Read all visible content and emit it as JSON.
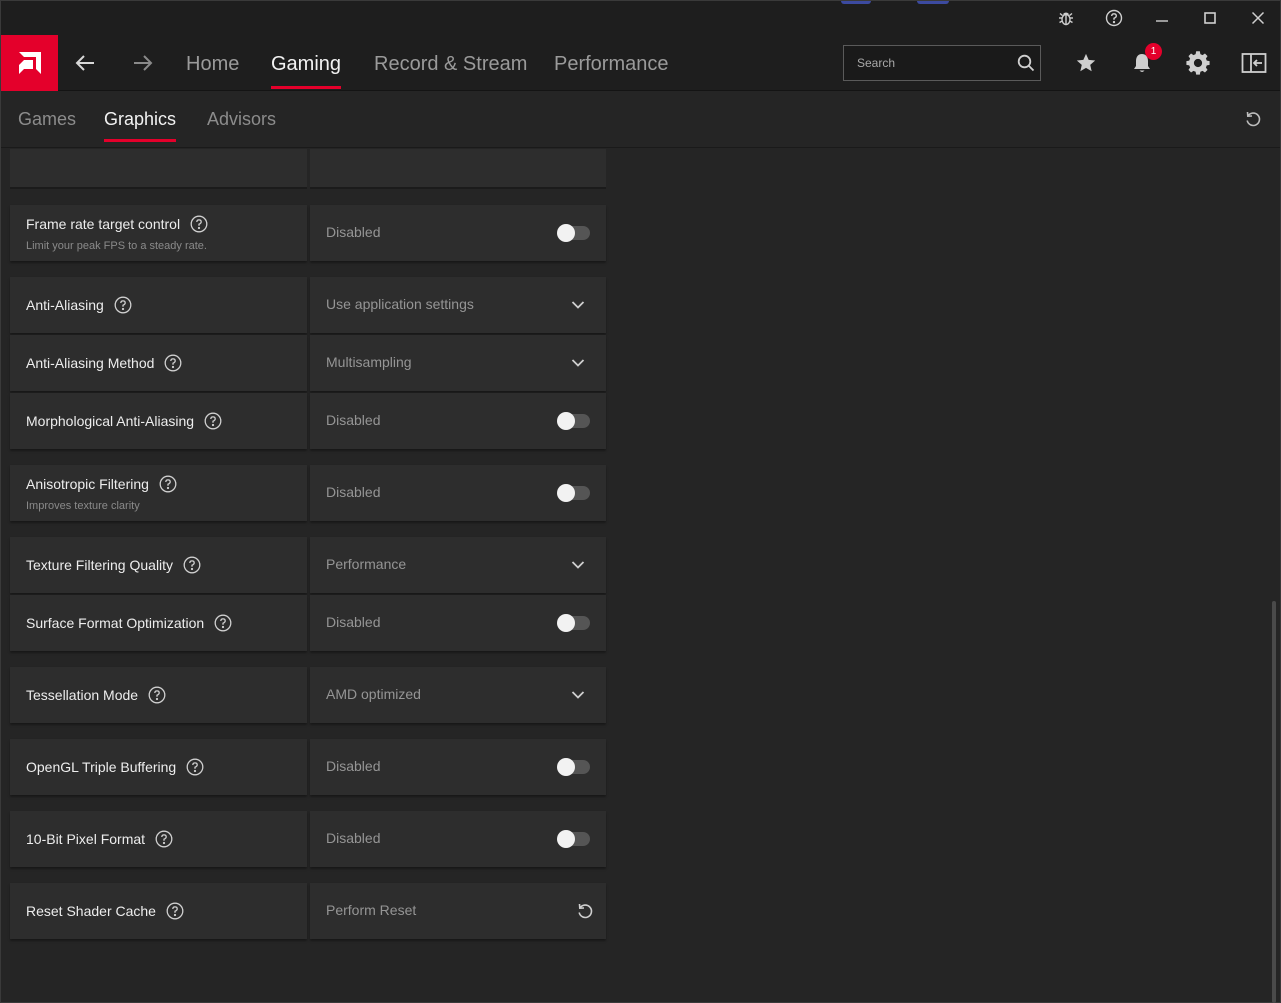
{
  "titlebar": {
    "icons": [
      "bug-icon",
      "help-icon",
      "minimize-icon",
      "maximize-icon",
      "close-icon"
    ]
  },
  "nav": {
    "links": [
      {
        "label": "Home",
        "active": false
      },
      {
        "label": "Gaming",
        "active": true
      },
      {
        "label": "Record & Stream",
        "active": false
      },
      {
        "label": "Performance",
        "active": false
      }
    ],
    "search_placeholder": "Search",
    "notification_count": "1"
  },
  "subtabs": [
    {
      "label": "Games",
      "active": false
    },
    {
      "label": "Graphics",
      "active": true
    },
    {
      "label": "Advisors",
      "active": false
    }
  ],
  "settings": [
    {
      "label": "Frame rate target control",
      "sublabel": "Limit your peak FPS to a steady rate.",
      "value": "Disabled",
      "control": "toggle",
      "on": false
    },
    {
      "label": "Anti-Aliasing",
      "value": "Use application settings",
      "control": "dropdown"
    },
    {
      "label": "Anti-Aliasing Method",
      "value": "Multisampling",
      "control": "dropdown"
    },
    {
      "label": "Morphological Anti-Aliasing",
      "value": "Disabled",
      "control": "toggle",
      "on": false
    },
    {
      "label": "Anisotropic Filtering",
      "sublabel": "Improves texture clarity",
      "value": "Disabled",
      "control": "toggle",
      "on": false
    },
    {
      "label": "Texture Filtering Quality",
      "value": "Performance",
      "control": "dropdown"
    },
    {
      "label": "Surface Format Optimization",
      "value": "Disabled",
      "control": "toggle",
      "on": false
    },
    {
      "label": "Tessellation Mode",
      "value": "AMD optimized",
      "control": "dropdown"
    },
    {
      "label": "OpenGL Triple Buffering",
      "value": "Disabled",
      "control": "toggle",
      "on": false
    },
    {
      "label": "10-Bit Pixel Format",
      "value": "Disabled",
      "control": "toggle",
      "on": false
    },
    {
      "label": "Reset Shader Cache",
      "value": "Perform Reset",
      "control": "reset"
    }
  ],
  "colors": {
    "accent": "#e4002b",
    "background": "#252525",
    "panel": "#2d2d2d",
    "bar": "#1e1e1e"
  }
}
